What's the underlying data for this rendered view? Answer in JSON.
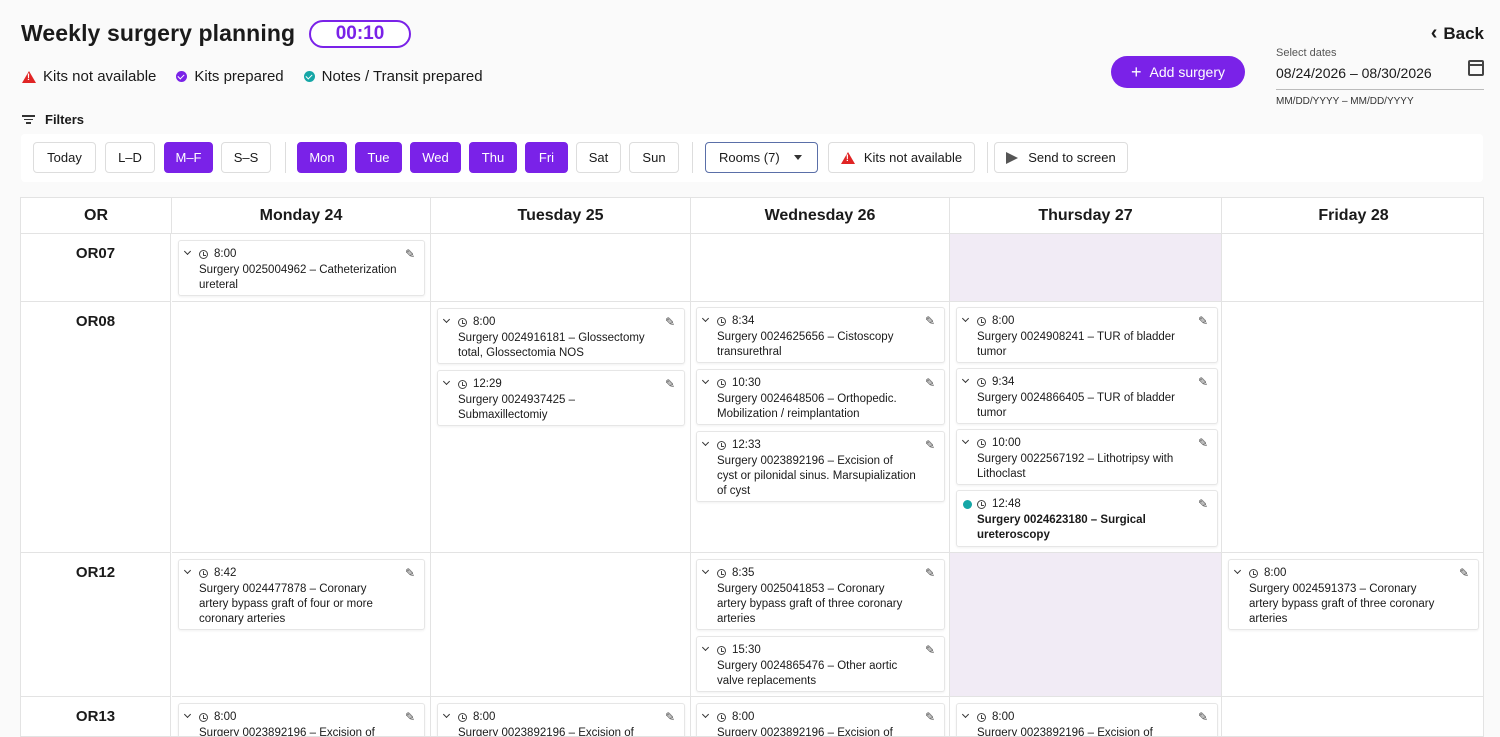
{
  "header": {
    "title": "Weekly surgery planning",
    "timer": "00:10",
    "back_label": "Back",
    "add_label": "Add surgery",
    "filters_label": "Filters"
  },
  "legend": {
    "kits_not_available": "Kits not available",
    "kits_prepared": "Kits prepared",
    "notes_prepared": "Notes / Transit prepared"
  },
  "dates": {
    "label": "Select dates",
    "value": "08/24/2026 – 08/30/2026",
    "format": "MM/DD/YYYY – MM/DD/YYYY"
  },
  "toolbar": {
    "today": "Today",
    "ld": "L–D",
    "mf": "M–F",
    "ss": "S–S",
    "mon": "Mon",
    "tue": "Tue",
    "wed": "Wed",
    "thu": "Thu",
    "fri": "Fri",
    "sat": "Sat",
    "sun": "Sun",
    "rooms": "Rooms (7)",
    "kits": "Kits not available",
    "send": "Send to screen"
  },
  "columns": [
    "OR",
    "Monday 24",
    "Tuesday 25",
    "Wednesday 26",
    "Thursday 27",
    "Friday 28"
  ],
  "rooms": [
    "OR07",
    "OR08",
    "OR12",
    "OR13"
  ],
  "cards": {
    "c1": {
      "time": "8:00",
      "line1": "Surgery 0025004962 – Catheterization",
      "line2": "ureteral",
      "line3": ""
    },
    "c2": {
      "time": "8:00",
      "line1": "Surgery 0024916181 – Glossectomy",
      "line2": "total, Glossectomia NOS",
      "line3": ""
    },
    "c3": {
      "time": "12:29",
      "line1": "Surgery 0024937425 –",
      "line2": "Submaxillectomiy",
      "line3": ""
    },
    "c4": {
      "time": "8:34",
      "line1": "Surgery 0024625656 – Cistoscopy",
      "line2": "transurethral",
      "line3": ""
    },
    "c5": {
      "time": "10:30",
      "line1": "Surgery 0024648506 – Orthopedic.",
      "line2": "Mobilization / reimplantation",
      "line3": ""
    },
    "c6": {
      "time": "12:33",
      "line1": "Surgery 0023892196 – Excision of",
      "line2": "cyst or pilonidal sinus. Marsupialization",
      "line3": "of cyst"
    },
    "c7": {
      "time": "8:00",
      "line1": "Surgery 0024908241 – TUR of bladder",
      "line2": "tumor",
      "line3": ""
    },
    "c8": {
      "time": "9:34",
      "line1": "Surgery 0024866405 – TUR of bladder",
      "line2": "tumor",
      "line3": ""
    },
    "c9": {
      "time": "10:00",
      "line1": "Surgery 0022567192 – Lithotripsy with",
      "line2": "Lithoclast",
      "line3": ""
    },
    "c10": {
      "time": "12:48",
      "line1": "Surgery 0024623180 – Surgical",
      "line2": "ureteroscopy",
      "line3": ""
    },
    "c11": {
      "time": "8:42",
      "line1": "Surgery 0024477878 – Coronary",
      "line2": "artery bypass graft of four or more",
      "line3": "coronary arteries"
    },
    "c12": {
      "time": "8:35",
      "line1": "Surgery 0025041853 – Coronary",
      "line2": "artery bypass graft of three coronary",
      "line3": "arteries"
    },
    "c13": {
      "time": "15:30",
      "line1": "Surgery 0024865476 – Other aortic",
      "line2": "valve replacements",
      "line3": ""
    },
    "c14": {
      "time": "8:00",
      "line1": "Surgery 0024591373 – Coronary",
      "line2": "artery bypass graft of three coronary",
      "line3": "arteries"
    },
    "c15": {
      "time": "8:00",
      "line1": "Surgery 0023892196 – Excision of",
      "line2": "",
      "line3": ""
    },
    "c16": {
      "time": "8:00",
      "line1": "Surgery 0023892196 – Excision of",
      "line2": "",
      "line3": ""
    },
    "c17": {
      "time": "8:00",
      "line1": "Surgery 0023892196 – Excision of",
      "line2": "",
      "line3": ""
    },
    "c18": {
      "time": "8:00",
      "line1": "Surgery 0023892196 – Excision of",
      "line2": "",
      "line3": ""
    }
  }
}
